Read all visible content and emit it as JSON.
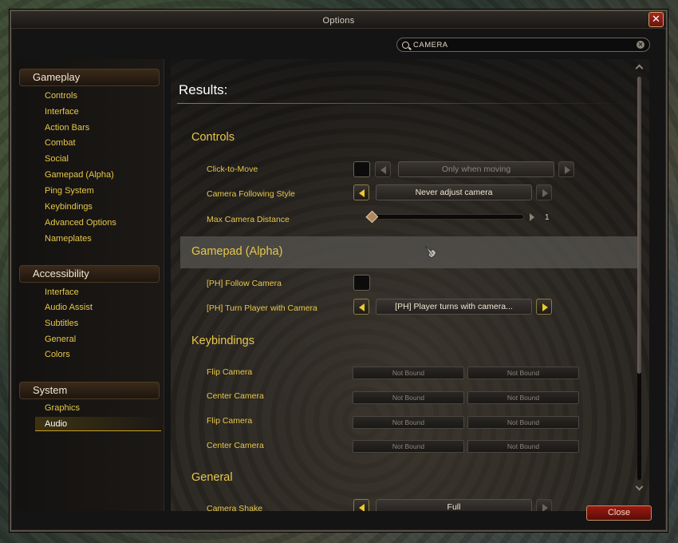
{
  "window": {
    "title": "Options",
    "close_label": "✕"
  },
  "search": {
    "value": "CAMERA",
    "clear_label": "×"
  },
  "sidebar": {
    "categories": [
      {
        "header": "Gameplay",
        "items": [
          "Controls",
          "Interface",
          "Action Bars",
          "Combat",
          "Social",
          "Gamepad (Alpha)",
          "Ping System",
          "Keybindings",
          "Advanced Options",
          "Nameplates"
        ]
      },
      {
        "header": "Accessibility",
        "items": [
          "Interface",
          "Audio Assist",
          "Subtitles",
          "General",
          "Colors"
        ]
      },
      {
        "header": "System",
        "items": [
          "Graphics",
          "Audio"
        ]
      }
    ],
    "selected": "Audio"
  },
  "main": {
    "results_title": "Results:",
    "sections": {
      "controls": {
        "title": "Controls",
        "click_to_move": {
          "label": "Click-to-Move",
          "value": "Only when moving"
        },
        "camera_following_style": {
          "label": "Camera Following Style",
          "value": "Never adjust camera"
        },
        "max_camera_distance": {
          "label": "Max Camera Distance",
          "value": "1"
        }
      },
      "gamepad": {
        "title": "Gamepad (Alpha)",
        "follow_camera": {
          "label": "[PH] Follow Camera"
        },
        "turn_player": {
          "label": "[PH] Turn Player with Camera",
          "value": "[PH] Player turns with camera..."
        }
      },
      "keybindings": {
        "title": "Keybindings",
        "rows": [
          {
            "label": "Flip Camera",
            "bind1": "Not Bound",
            "bind2": "Not Bound"
          },
          {
            "label": "Center Camera",
            "bind1": "Not Bound",
            "bind2": "Not Bound"
          },
          {
            "label": "Flip Camera",
            "bind1": "Not Bound",
            "bind2": "Not Bound"
          },
          {
            "label": "Center Camera",
            "bind1": "Not Bound",
            "bind2": "Not Bound"
          }
        ]
      },
      "general": {
        "title": "General",
        "camera_shake": {
          "label": "Camera Shake",
          "value": "Full"
        }
      }
    }
  },
  "footer": {
    "close_label": "Close"
  },
  "colors": {
    "gold_text": "#e6c74a",
    "close_red": "#9a1a12",
    "accent_gold": "#f0c828"
  }
}
